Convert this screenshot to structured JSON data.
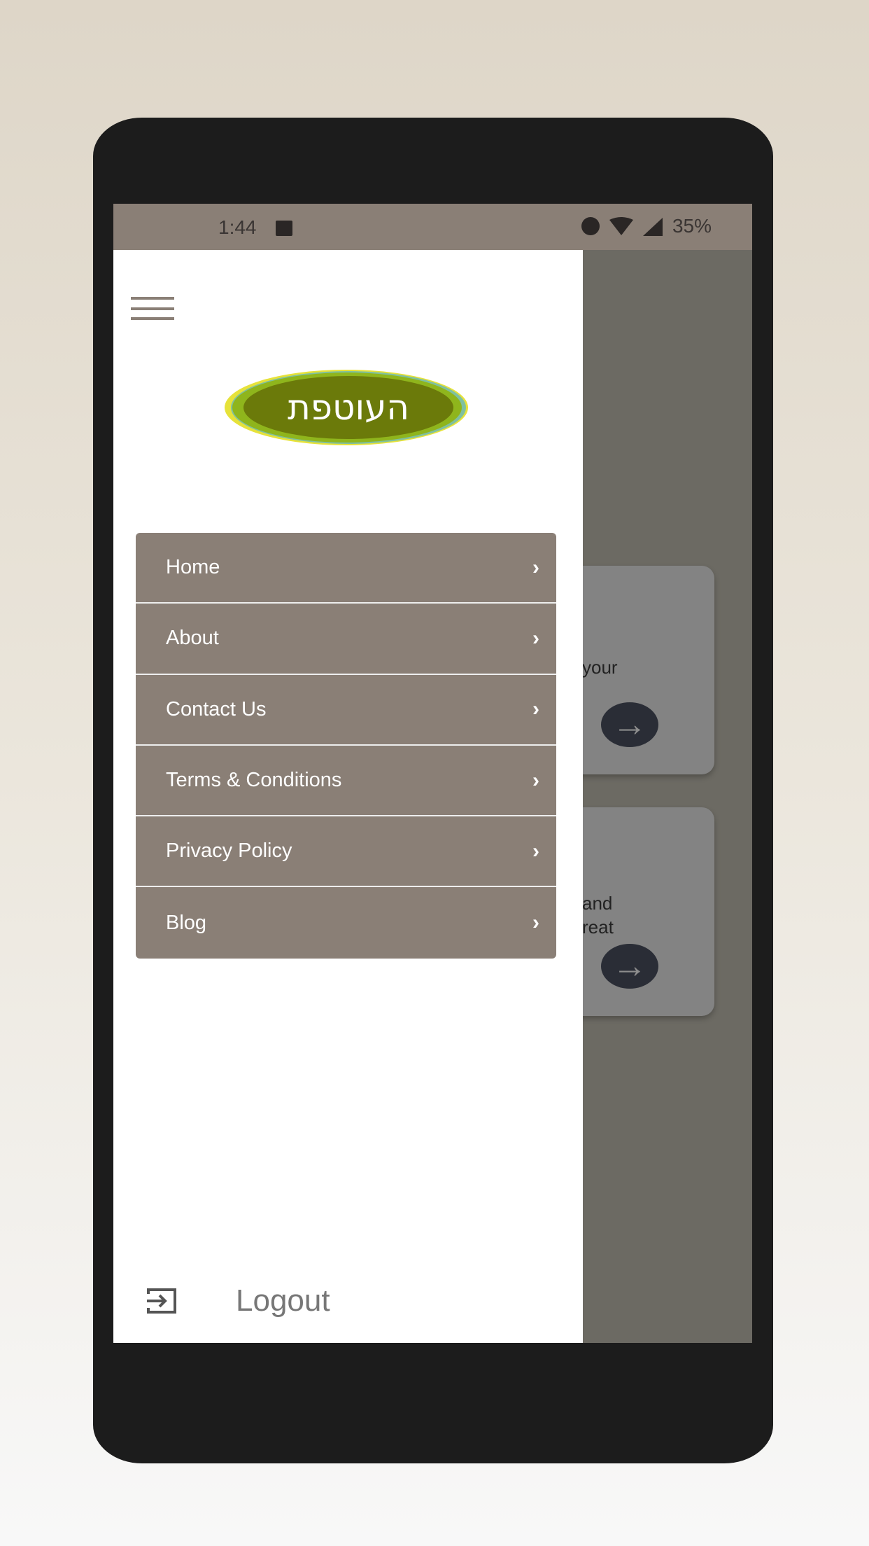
{
  "status_bar": {
    "time": "1:44",
    "battery": "35%",
    "icons": [
      "image-icon",
      "alarm-icon",
      "wifi-icon",
      "signal-icon"
    ]
  },
  "drawer": {
    "logo_text": "העוטפת",
    "menu": [
      {
        "label": "Home"
      },
      {
        "label": "About"
      },
      {
        "label": "Contact Us"
      },
      {
        "label": "Terms & Conditions"
      },
      {
        "label": "Privacy Policy"
      },
      {
        "label": "Blog"
      }
    ],
    "logout_label": "Logout"
  },
  "background_cards": [
    {
      "text": "your"
    },
    {
      "text": "and\nreat"
    }
  ],
  "colors": {
    "accent": "#8a7f76",
    "logo_green": "#6b7a0a",
    "scrim": "#6c6a63"
  }
}
